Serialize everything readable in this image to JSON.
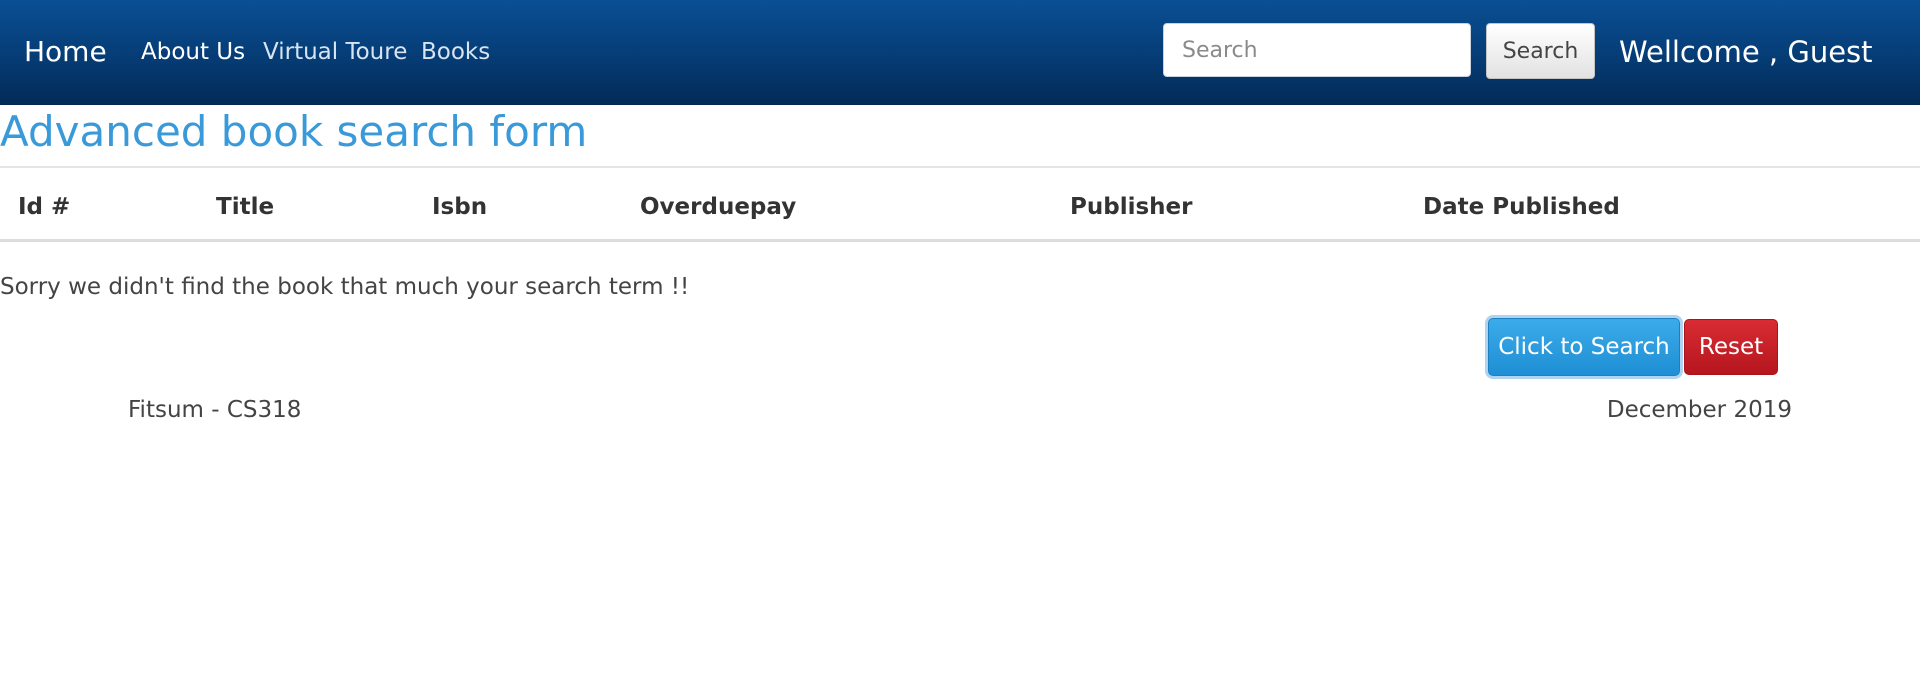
{
  "navbar": {
    "brand": "Home",
    "links": [
      {
        "label": "About Us"
      },
      {
        "label": "Virtual Toure"
      },
      {
        "label": "Books"
      }
    ],
    "search": {
      "placeholder": "Search",
      "value": "",
      "button_label": "Search"
    },
    "welcome": "Wellcome , Guest"
  },
  "page": {
    "title": "Advanced book search form"
  },
  "table": {
    "headers": [
      "Id #",
      "Title",
      "Isbn",
      "Overduepay",
      "Publisher",
      "Date Published"
    ],
    "rows": []
  },
  "messages": {
    "empty": "Sorry we didn't find the book that much your search term !!"
  },
  "actions": {
    "search_label": "Click to Search",
    "reset_label": "Reset"
  },
  "footer": {
    "left": "Fitsum - CS318",
    "right": "December 2019"
  },
  "colors": {
    "navbar": "#063e78",
    "title": "#3a9ad9",
    "primary": "#1e8fd4",
    "danger": "#b5161e"
  }
}
